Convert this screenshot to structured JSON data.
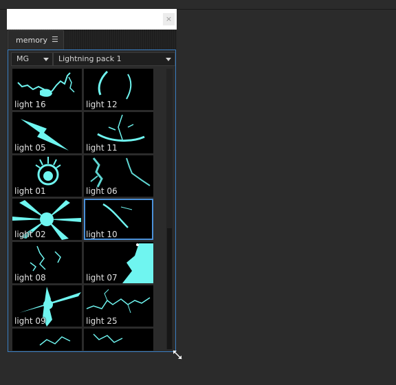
{
  "window": {
    "close_glyph": "×"
  },
  "tab": {
    "label": "memory",
    "menu_glyph": "☰"
  },
  "toolbar": {
    "category": {
      "value": "MG"
    },
    "pack": {
      "value": "Lightning pack 1"
    }
  },
  "accent_color": "#6ff5f0",
  "thumbnails": [
    {
      "label": "light 16",
      "icon": "lightning-chain-icon"
    },
    {
      "label": "light 12",
      "icon": "lightning-arc-icon"
    },
    {
      "label": "light 05",
      "icon": "lightning-bolt-icon"
    },
    {
      "label": "light 11",
      "icon": "lightning-swirl-icon"
    },
    {
      "label": "light 01",
      "icon": "lightning-ball-icon"
    },
    {
      "label": "light 06",
      "icon": "lightning-branch-icon"
    },
    {
      "label": "light 02",
      "icon": "lightning-burst-icon",
      "text": "light 02"
    },
    {
      "label": "light 10",
      "icon": "lightning-streak-icon",
      "selected": true
    },
    {
      "label": "light 08",
      "icon": "lightning-sparks-icon"
    },
    {
      "label": "light 07",
      "icon": "lightning-beam-icon"
    },
    {
      "label": "light 09",
      "icon": "lightning-cross-icon"
    },
    {
      "label": "light 25",
      "icon": "lightning-crackle-icon"
    },
    {
      "label": "",
      "icon": "lightning-partial-icon"
    },
    {
      "label": "",
      "icon": "lightning-partial-icon"
    }
  ]
}
